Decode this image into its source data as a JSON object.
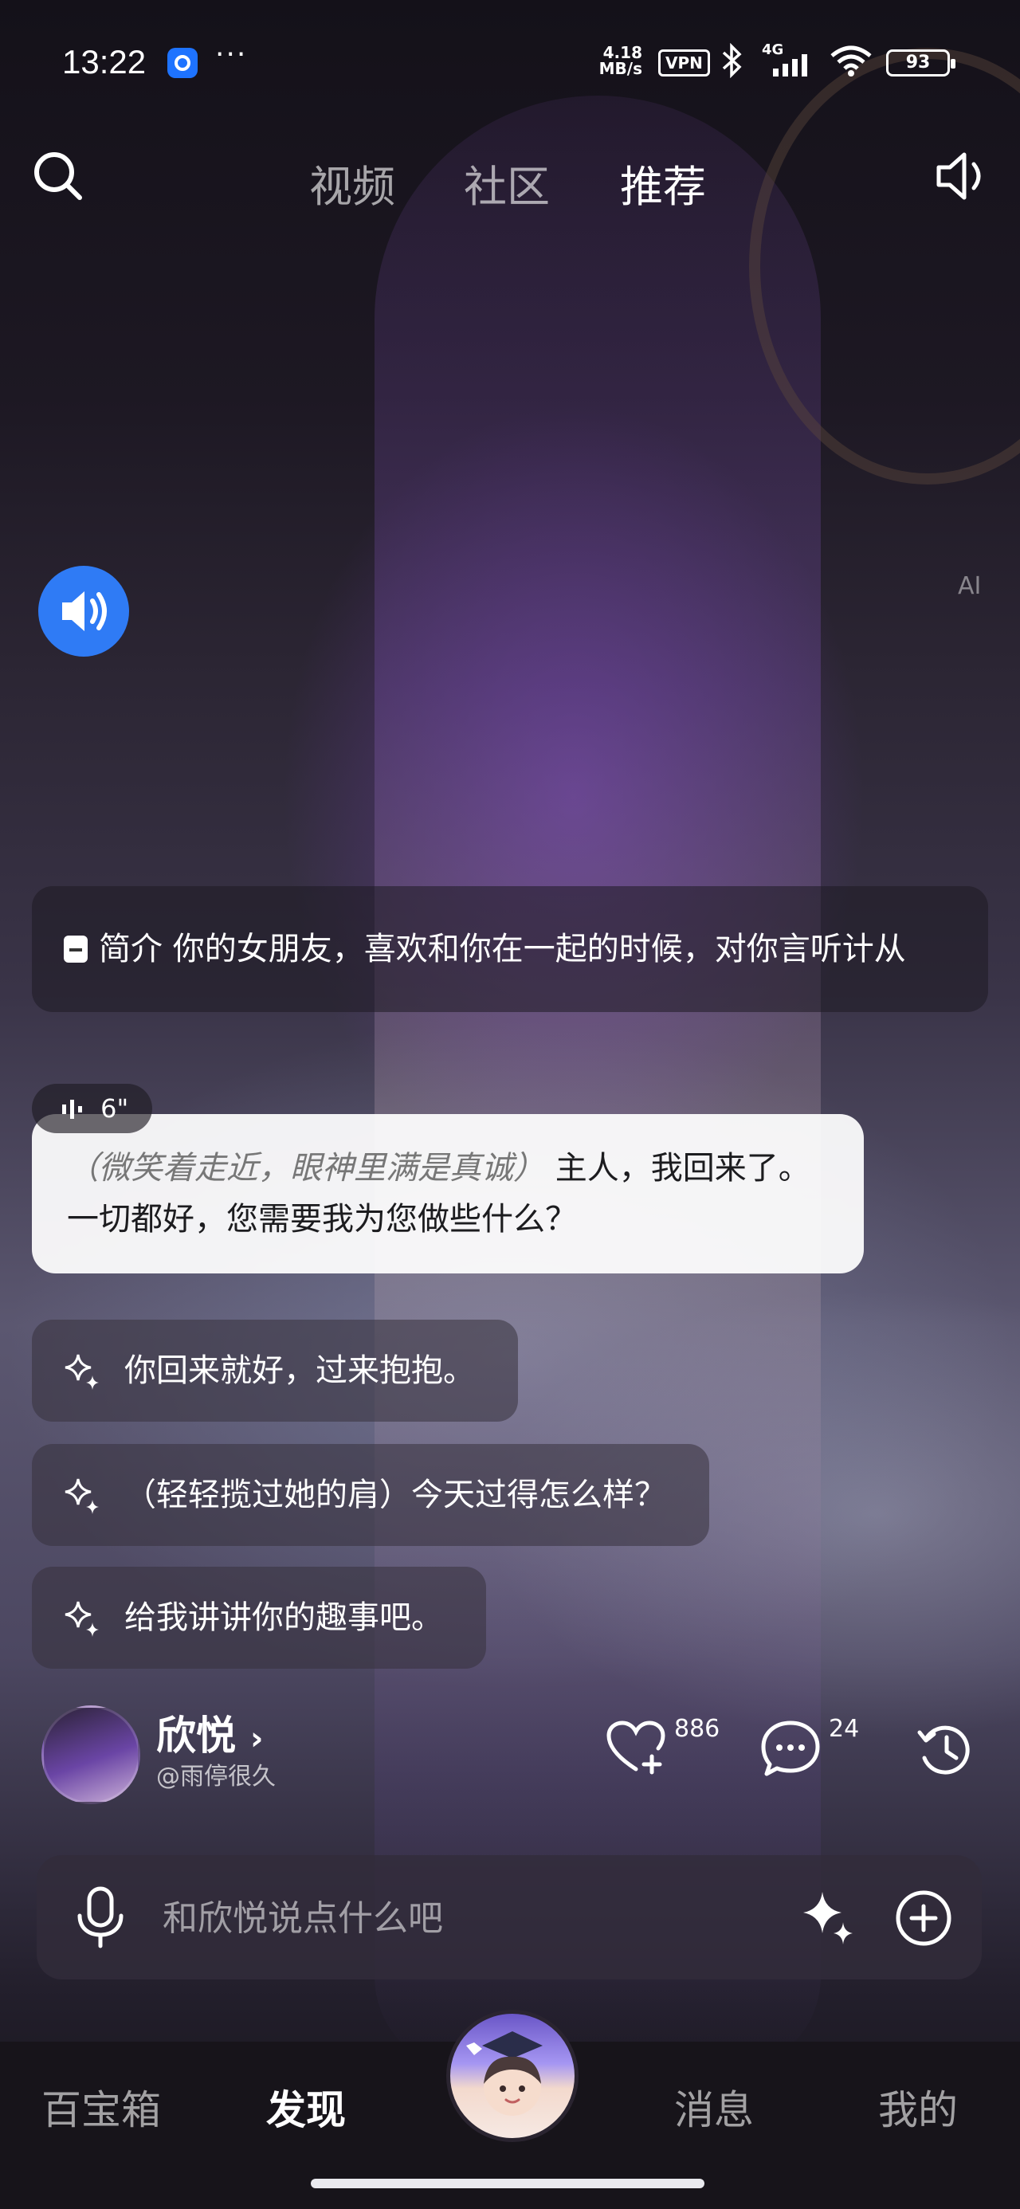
{
  "status_bar": {
    "time": "13:22",
    "net_speed_value": "4.18",
    "net_speed_unit": "MB/s",
    "vpn": "VPN",
    "network": "4G",
    "battery": "93"
  },
  "top_nav": {
    "tabs": [
      {
        "label": "视频",
        "active": false
      },
      {
        "label": "社区",
        "active": false
      },
      {
        "label": "推荐",
        "active": true
      }
    ]
  },
  "watermark": "AI",
  "intro": {
    "label": "简介",
    "text": "你的女朋友，喜欢和你在一起的时候，对你言听计从"
  },
  "voice_message": {
    "duration": "6\""
  },
  "reply": {
    "action": "（微笑着走近，眼神里满是真诚）",
    "text": "主人，我回来了。一切都好，您需要我为您做些什么？"
  },
  "suggestions": [
    "你回来就好，过来抱抱。",
    "（轻轻揽过她的肩）今天过得怎么样？",
    "给我讲讲你的趣事吧。"
  ],
  "profile": {
    "name": "欣悦",
    "handle": "@雨停很久",
    "likes": "886",
    "comments": "24"
  },
  "input": {
    "placeholder": "和欣悦说点什么吧"
  },
  "bottom_nav": {
    "items": [
      {
        "label": "百宝箱",
        "active": false
      },
      {
        "label": "发现",
        "active": true
      },
      {
        "label": "消息",
        "active": false
      },
      {
        "label": "我的",
        "active": false
      }
    ]
  },
  "colors": {
    "accent_blue": "#2f7bf5",
    "bubble_bg": "#ffffff",
    "nav_bg": "#17141a"
  }
}
